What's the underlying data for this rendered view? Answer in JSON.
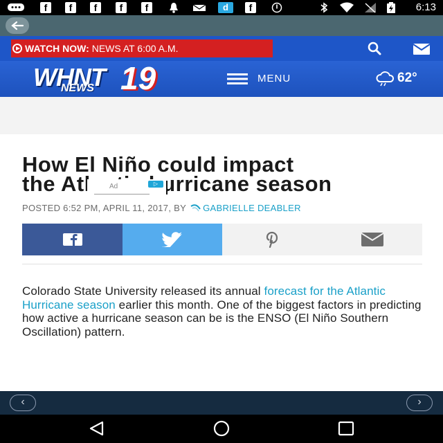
{
  "status_bar": {
    "time": "6:13",
    "left_icons": [
      "chat-bubble-icon",
      "facebook-icon",
      "facebook-icon",
      "facebook-icon",
      "facebook-icon",
      "facebook-icon",
      "alarm-icon",
      "mail-notify-icon",
      "dictionary-d-icon",
      "facebook-icon",
      "sync-icon"
    ],
    "right_icons": [
      "bluetooth-icon",
      "wifi-icon",
      "no-signal-icon",
      "battery-charging-icon"
    ],
    "fb_letter": "f",
    "d_letter": "d"
  },
  "toolbar": {
    "back_icon": "back-arrow-icon"
  },
  "top_row": {
    "watch_label": "WATCH NOW:",
    "watch_text": "NEWS AT 6:00 A.M.",
    "search_icon": "search-icon",
    "mail_icon": "mail-icon"
  },
  "header": {
    "logo_word": "WHNT",
    "logo_sub": "NEWS",
    "logo_num": "19",
    "menu_label": "MENU",
    "temperature": "62°",
    "weather_icon": "cloud-drizzle-icon"
  },
  "article": {
    "title_line1": "How El Niño could impact",
    "title_line2": "the Atlantic hurricane season",
    "ad_label": "Ad",
    "byline_posted": "POSTED 6:52 PM, APRIL 11, 2017, BY",
    "byline_author": "GABRIELLE DEABLER",
    "body_pre": "Colorado State University released its annual ",
    "body_link": "forecast for the Atlantic Hurricane season",
    "body_post": " earlier this month. One of the biggest factors in predicting how active a hurricane season can be is the ENSO (El Niño Southern Oscillation) pattern."
  },
  "share": {
    "facebook_icon": "facebook-icon",
    "twitter_icon": "twitter-icon",
    "pinterest_icon": "pinterest-icon",
    "email_icon": "email-icon",
    "colors": {
      "facebook": "#3b5998",
      "twitter": "#55acee",
      "neutral": "#f2f2f2"
    }
  },
  "pager": {
    "prev": "‹",
    "next": "›"
  },
  "nav": {
    "back_icon": "nav-back-icon",
    "home_icon": "nav-home-icon",
    "recents_icon": "nav-recents-icon"
  },
  "colors": {
    "brand_blue": "#1e56c8",
    "watch_red": "#d42021",
    "link": "#1aa0c8"
  }
}
